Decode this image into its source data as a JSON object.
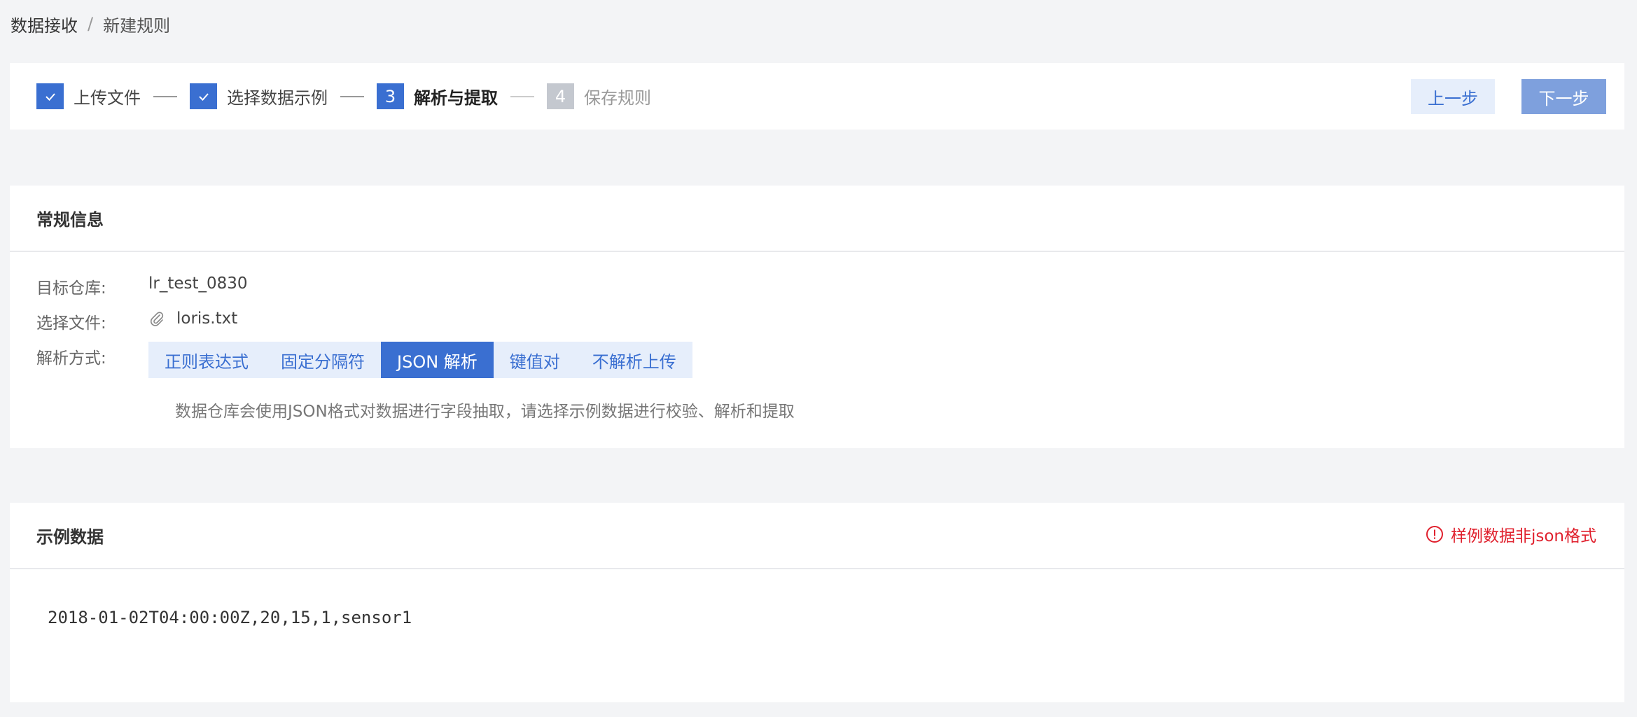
{
  "breadcrumb": {
    "root": "数据接收",
    "separator": "/",
    "current": "新建规则"
  },
  "steps": [
    {
      "number": "",
      "label": "上传文件",
      "state": "done"
    },
    {
      "number": "",
      "label": "选择数据示例",
      "state": "done"
    },
    {
      "number": "3",
      "label": "解析与提取",
      "state": "active"
    },
    {
      "number": "4",
      "label": "保存规则",
      "state": "pending"
    }
  ],
  "actions": {
    "prev_label": "上一步",
    "next_label": "下一步"
  },
  "general": {
    "title": "常规信息",
    "target_repo_label": "目标仓库:",
    "target_repo_value": "lr_test_0830",
    "file_label": "选择文件:",
    "file_value": "loris.txt",
    "parse_label": "解析方式:",
    "parse_options": [
      "正则表达式",
      "固定分隔符",
      "JSON 解析",
      "键值对",
      "不解析上传"
    ],
    "parse_selected": "JSON 解析",
    "hint": "数据仓库会使用JSON格式对数据进行字段抽取，请选择示例数据进行校验、解析和提取"
  },
  "sample": {
    "title": "示例数据",
    "error": "样例数据非json格式",
    "line": "2018-01-02T04:00:00Z,20,15,1,sensor1"
  },
  "colors": {
    "primary": "#3a6fd1",
    "error": "#e0202d",
    "pending": "#c4c8cf"
  }
}
